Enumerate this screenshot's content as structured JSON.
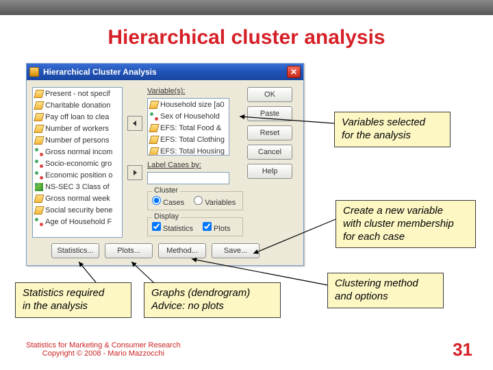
{
  "slide": {
    "title": "Hierarchical cluster analysis",
    "page_number": "31",
    "footer_line1": "Statistics for Marketing & Consumer Research",
    "footer_line2": "Copyright © 2008 - Mario Mazzocchi"
  },
  "dialog": {
    "title": "Hierarchical Cluster Analysis",
    "labels": {
      "variables": "Variable(s):",
      "label_cases": "Label Cases by:",
      "cluster_group": "Cluster",
      "display_group": "Display",
      "cases_radio": "Cases",
      "variables_radio": "Variables",
      "stats_check": "Statistics",
      "plots_check": "Plots"
    },
    "source_vars": [
      {
        "icon": "ruler",
        "text": "Present - not specif"
      },
      {
        "icon": "ruler",
        "text": "Charitable donation"
      },
      {
        "icon": "ruler",
        "text": "Pay off loan to clea"
      },
      {
        "icon": "ruler",
        "text": "Number of workers"
      },
      {
        "icon": "ruler",
        "text": "Number of persons"
      },
      {
        "icon": "nom",
        "text": "Gross normal incom"
      },
      {
        "icon": "nom",
        "text": "Socio-economic gro"
      },
      {
        "icon": "nom",
        "text": "Economic position o"
      },
      {
        "icon": "ord",
        "text": "NS-SEC 3 Class of"
      },
      {
        "icon": "ruler",
        "text": "Gross normal week"
      },
      {
        "icon": "ruler",
        "text": "Social security bene"
      },
      {
        "icon": "nom",
        "text": "Age of Household F"
      }
    ],
    "selected_vars": [
      {
        "icon": "ruler",
        "text": "Household size [a0"
      },
      {
        "icon": "nom",
        "text": "Sex of Household"
      },
      {
        "icon": "ruler",
        "text": "EFS: Total Food &"
      },
      {
        "icon": "ruler",
        "text": "EFS: Total Clothing"
      },
      {
        "icon": "ruler",
        "text": "EFS: Total Housing"
      }
    ],
    "label_case_value": "",
    "buttons": {
      "ok": "OK",
      "paste": "Paste",
      "reset": "Reset",
      "cancel": "Cancel",
      "help": "Help"
    },
    "bottom_buttons": {
      "statistics": "Statistics...",
      "plots": "Plots...",
      "method": "Method...",
      "save": "Save..."
    }
  },
  "callouts": {
    "c1_l1": "Variables selected",
    "c1_l2": "for the analysis",
    "c2_l1": "Create a new variable",
    "c2_l2": "with cluster membership",
    "c2_l3": "for each case",
    "c3_l1": "Statistics required",
    "c3_l2": "in the analysis",
    "c4_l1": "Graphs (dendrogram)",
    "c4_l2": "Advice: no plots",
    "c5_l1": "Clustering method",
    "c5_l2": "and options"
  }
}
